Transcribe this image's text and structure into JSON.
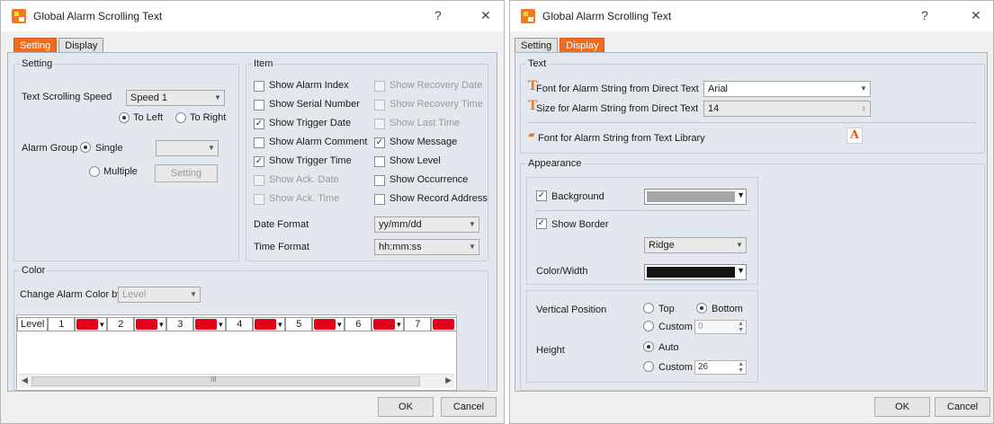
{
  "left": {
    "title": "Global Alarm Scrolling Text",
    "help": "?",
    "close": "✕",
    "tabs": [
      "Setting",
      "Display"
    ],
    "setting_group": {
      "title": "Setting",
      "speed_label": "Text Scrolling Speed",
      "speed_value": "Speed 1",
      "to_left": "To Left",
      "to_right": "To Right",
      "alarm_group_label": "Alarm Group",
      "single": "Single",
      "multiple": "Multiple",
      "setting_button": "Setting"
    },
    "item_group": {
      "title": "Item",
      "items": [
        {
          "label": "Show Alarm Index",
          "checked": false,
          "enabled": true
        },
        {
          "label": "Show Recovery Date",
          "checked": false,
          "enabled": false
        },
        {
          "label": "Show Serial Number",
          "checked": false,
          "enabled": true
        },
        {
          "label": "Show Recovery Time",
          "checked": false,
          "enabled": false
        },
        {
          "label": "Show Trigger Date",
          "checked": true,
          "enabled": true
        },
        {
          "label": "Show Last Time",
          "checked": false,
          "enabled": false
        },
        {
          "label": "Show Alarm Comment",
          "checked": false,
          "enabled": true
        },
        {
          "label": "Show Message",
          "checked": true,
          "enabled": true
        },
        {
          "label": "Show Trigger Time",
          "checked": true,
          "enabled": true
        },
        {
          "label": "Show Level",
          "checked": false,
          "enabled": true
        },
        {
          "label": "Show Ack. Date",
          "checked": false,
          "enabled": false
        },
        {
          "label": "Show Occurrence",
          "checked": false,
          "enabled": true
        },
        {
          "label": "Show Ack. Time",
          "checked": false,
          "enabled": false
        },
        {
          "label": "Show Record Address",
          "checked": false,
          "enabled": true
        }
      ],
      "date_format_label": "Date Format",
      "date_format_value": "yy/mm/dd",
      "time_format_label": "Time Format",
      "time_format_value": "hh:mm:ss"
    },
    "color_group": {
      "title": "Color",
      "change_by_label": "Change Alarm Color by",
      "change_by_value": "Level",
      "level_header": "Level",
      "levels": [
        "1",
        "2",
        "3",
        "4",
        "5",
        "6",
        "7"
      ],
      "level_color": "#e3001b",
      "scroll_grip": "III"
    },
    "ok": "OK",
    "cancel": "Cancel"
  },
  "right": {
    "title": "Global Alarm Scrolling Text",
    "help": "?",
    "close": "✕",
    "tabs": [
      "Setting",
      "Display"
    ],
    "text_group": {
      "title": "Text",
      "font_direct_label": "Font for Alarm String from Direct Text",
      "font_direct_value": "Arial",
      "size_direct_label": "Size for Alarm String from Direct Text",
      "size_direct_value": "14",
      "font_library_label": "Font for Alarm String from Text Library"
    },
    "appearance_group": {
      "title": "Appearance",
      "background_label": "Background",
      "background_checked": true,
      "background_color": "#a6a6a6",
      "show_border_label": "Show Border",
      "show_border_checked": true,
      "border_style_value": "Ridge",
      "color_width_label": "Color/Width",
      "border_color": "#141414",
      "vertical_position_label": "Vertical Position",
      "top": "Top",
      "bottom": "Bottom",
      "custom_pos": "Custom",
      "custom_pos_value": "0",
      "height_label": "Height",
      "auto": "Auto",
      "custom_height": "Custom",
      "custom_height_value": "26"
    },
    "ok": "OK",
    "cancel": "Cancel"
  },
  "accent_color": "#f26b1d"
}
